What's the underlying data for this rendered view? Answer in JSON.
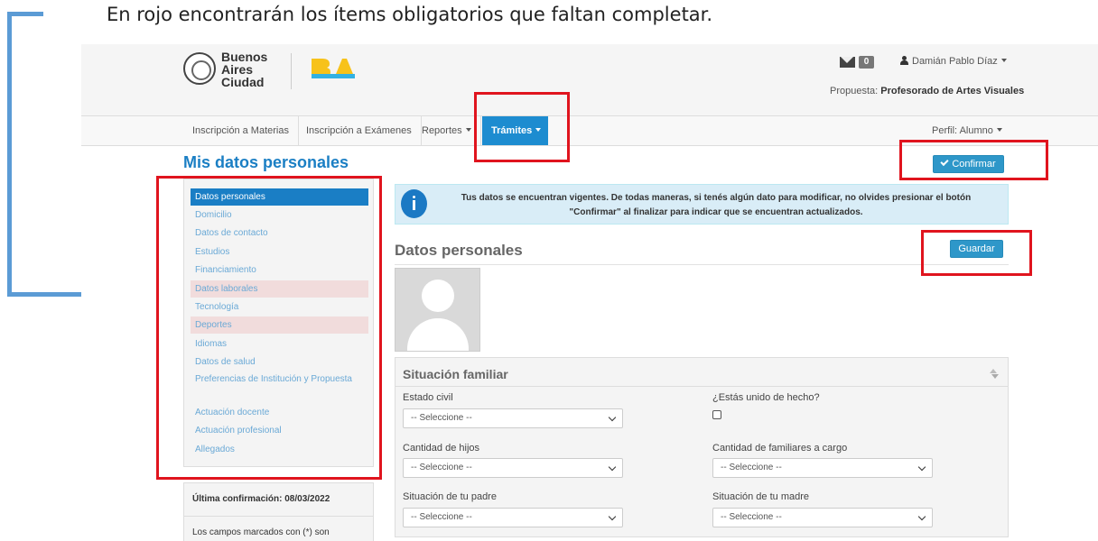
{
  "caption": "En rojo encontrarán los ítems obligatorios que faltan completar.",
  "header": {
    "city_logo": "Buenos Aires Ciudad",
    "city_logo_lines": [
      "Buenos",
      "Aires",
      "Ciudad"
    ],
    "ba_logo": "BA",
    "mail_count": "0",
    "user_name": "Damián Pablo Díaz",
    "propuesta_label": "Propuesta:",
    "propuesta_value": "Profesorado de Artes Visuales"
  },
  "nav": {
    "items": [
      "Inscripción a Materias",
      "Inscripción a Exámenes",
      "Reportes",
      "Trámites"
    ],
    "perfil": "Perfil: Alumno"
  },
  "page": {
    "title": "Mis datos personales",
    "confirm_button": "Confirmar",
    "save_button": "Guardar",
    "info_text": "Tus datos se encuentran vigentes. De todas maneras, si tenés algún dato para modificar, no olvides presionar el botón \"Confirmar\" al finalizar para indicar que se encuentran actualizados.",
    "section_title": "Datos personales"
  },
  "sidebar": {
    "items": [
      {
        "label": "Datos personales",
        "state": "active"
      },
      {
        "label": "Domicilio",
        "state": "normal"
      },
      {
        "label": "Datos de contacto",
        "state": "normal"
      },
      {
        "label": "Estudios",
        "state": "normal"
      },
      {
        "label": "Financiamiento",
        "state": "normal"
      },
      {
        "label": "Datos laborales",
        "state": "required"
      },
      {
        "label": "Tecnología",
        "state": "normal"
      },
      {
        "label": "Deportes",
        "state": "required"
      },
      {
        "label": "Idiomas",
        "state": "normal"
      },
      {
        "label": "Datos de salud",
        "state": "normal"
      },
      {
        "label": "Preferencias de Institución y Propuesta",
        "state": "normal"
      },
      {
        "label": "Actuación docente",
        "state": "normal"
      },
      {
        "label": "Actuación profesional",
        "state": "normal"
      },
      {
        "label": "Allegados",
        "state": "normal"
      }
    ],
    "last_confirmation": "Última confirmación: 08/03/2022",
    "required_note": "Los campos marcados con (*) son obligatorios"
  },
  "familia": {
    "title": "Situación familiar",
    "estado_civil_label": "Estado civil",
    "estado_civil_value": "-- Seleccione --",
    "union_label": "¿Estás unido de hecho?",
    "union_checked": false,
    "hijos_label": "Cantidad de hijos",
    "hijos_value": "-- Seleccione --",
    "familiares_label": "Cantidad de familiares a cargo",
    "familiares_value": "-- Seleccione --",
    "padre_label": "Situación de tu padre",
    "padre_value": "-- Seleccione --",
    "madre_label": "Situación de tu madre",
    "madre_value": "-- Seleccione --"
  },
  "colors": {
    "highlight_red": "#e0141e",
    "arrow_blue": "#5b9bd5",
    "primary_blue": "#1a7ec5",
    "button_blue": "#2e97c9",
    "required_bg": "#f1dcdc"
  }
}
